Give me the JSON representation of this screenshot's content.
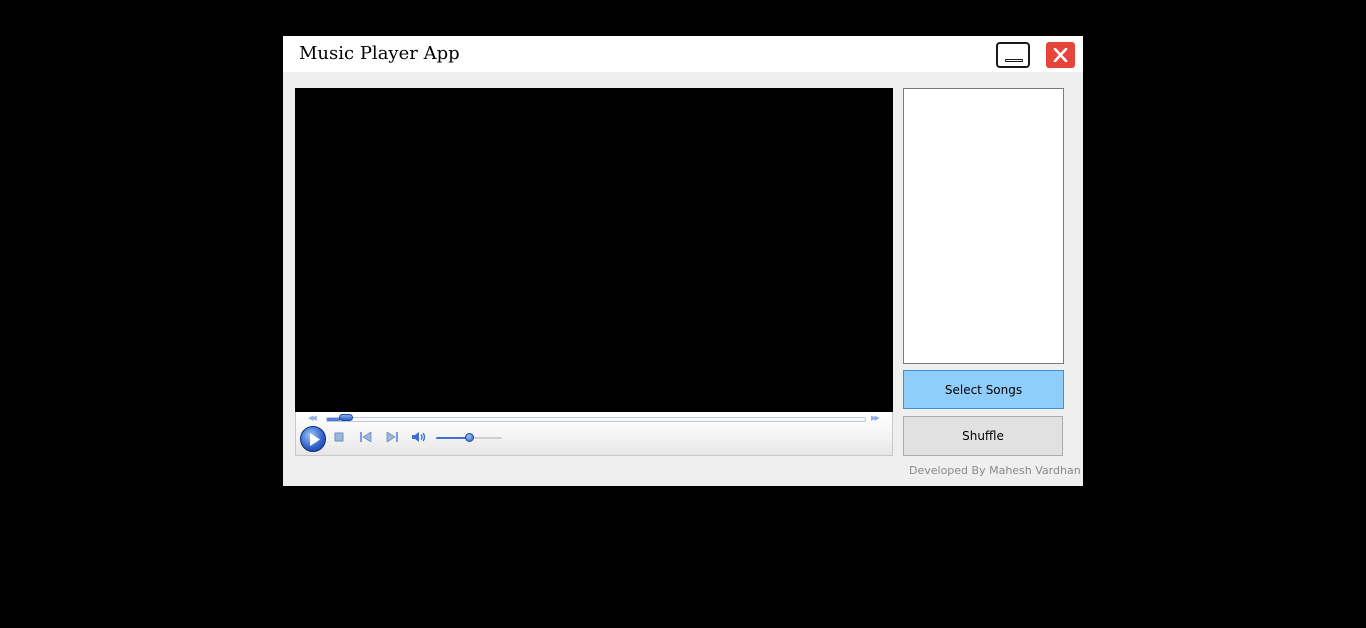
{
  "window": {
    "title": "Music Player App",
    "minimize_icon": "minimize-icon",
    "close_icon": "close-icon",
    "close_color": "#e5453a"
  },
  "player": {
    "seek_fraction": 0.025,
    "volume_fraction": 0.5,
    "icons": [
      "play-icon",
      "stop-icon",
      "previous-icon",
      "next-icon",
      "volume-icon",
      "rewind-icon",
      "fast-forward-icon"
    ],
    "accent_color": "#2c5fc7"
  },
  "sidebar": {
    "select_songs_label": "Select Songs",
    "select_songs_color": "#8fcdfb",
    "shuffle_label": "Shuffle"
  },
  "footer": {
    "credit": "Developed By Mahesh Vardhan"
  }
}
